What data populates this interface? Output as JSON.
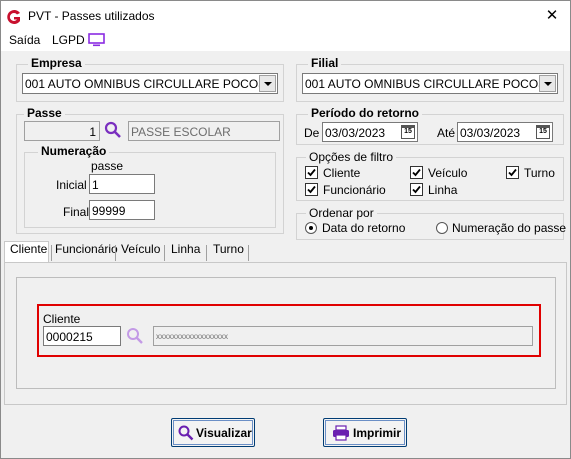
{
  "window": {
    "title": "PVT - Passes utilizados",
    "close_label": "✕"
  },
  "menu": {
    "items": [
      "Saída",
      "LGPD"
    ]
  },
  "empresa": {
    "label": "Empresa",
    "value": "001 AUTO OMNIBUS CIRCULLARE POCOS DE"
  },
  "filial": {
    "label": "Filial",
    "value": "001 AUTO OMNIBUS CIRCULLARE POCOS DE"
  },
  "passe": {
    "label": "Passe",
    "code": "1",
    "description_placeholder": "PASSE ESCOLAR",
    "numeracao": {
      "label": "Numeração",
      "sublabel": "passe",
      "inicial_label": "Inicial",
      "inicial_value": "1",
      "final_label": "Final",
      "final_value": "99999"
    }
  },
  "periodo": {
    "label": "Período do retorno",
    "de_label": "De",
    "de_value": "03/03/2023",
    "ate_label": "Até",
    "ate_value": "03/03/2023",
    "cal_label": "15"
  },
  "opcoes": {
    "label": "Opções de filtro",
    "items": [
      {
        "label": "Cliente",
        "checked": true
      },
      {
        "label": "Veículo",
        "checked": true
      },
      {
        "label": "Turno",
        "checked": true
      },
      {
        "label": "Funcionário",
        "checked": true
      },
      {
        "label": "Linha",
        "checked": true
      }
    ]
  },
  "ordenar": {
    "label": "Ordenar por",
    "options": [
      "Data do retorno",
      "Numeração do passe"
    ],
    "selected": "Data do retorno"
  },
  "tabs": [
    "Cliente",
    "Funcionário",
    "Veículo",
    "Linha",
    "Turno"
  ],
  "active_tab": "Cliente",
  "cliente": {
    "label": "Cliente",
    "code": "0000215",
    "name": "xxxxxxxxxxxxxxxxxx"
  },
  "buttons": {
    "visualizar": "Visualizar",
    "imprimir": "Imprimir"
  },
  "colors": {
    "highlight_border": "#e00000",
    "search_icon": "#7a2fbf",
    "brand_logo": "#c8102e"
  }
}
